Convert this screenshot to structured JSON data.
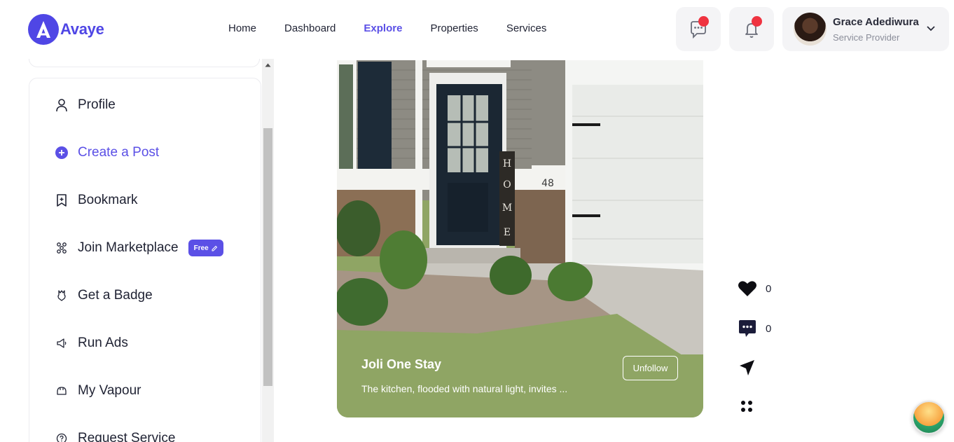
{
  "brand": {
    "name": "Avaye",
    "accent": "#5b50e6",
    "alert": "#ef3340"
  },
  "nav": {
    "items": [
      {
        "label": "Home",
        "active": false
      },
      {
        "label": "Dashboard",
        "active": false
      },
      {
        "label": "Explore",
        "active": true
      },
      {
        "label": "Properties",
        "active": false
      },
      {
        "label": "Services",
        "active": false
      }
    ]
  },
  "header": {
    "messages_icon": "chat-bubble-icon",
    "notifications_icon": "bell-icon"
  },
  "user": {
    "name": "Grace Adediwura",
    "role": "Service Provider"
  },
  "sidebar": {
    "items": [
      {
        "label": "Profile",
        "icon": "user-icon"
      },
      {
        "label": "Create a Post",
        "icon": "plus-circle-icon"
      },
      {
        "label": "Bookmark",
        "icon": "bookmark-icon"
      },
      {
        "label": "Join Marketplace",
        "icon": "marketplace-icon",
        "badge": "Free"
      },
      {
        "label": "Get a Badge",
        "icon": "badge-icon"
      },
      {
        "label": "Run Ads",
        "icon": "megaphone-icon"
      },
      {
        "label": "My Vapour",
        "icon": "vapour-icon"
      },
      {
        "label": "Request Service",
        "icon": "help-circle-icon"
      }
    ]
  },
  "post": {
    "title": "Joli One Stay",
    "description": "The kitchen, flooded with natural light, invites ...",
    "follow_label": "Unfollow",
    "house_number": "48",
    "door_sign": "HOME"
  },
  "actions": {
    "likes": "0",
    "comments": "0"
  }
}
